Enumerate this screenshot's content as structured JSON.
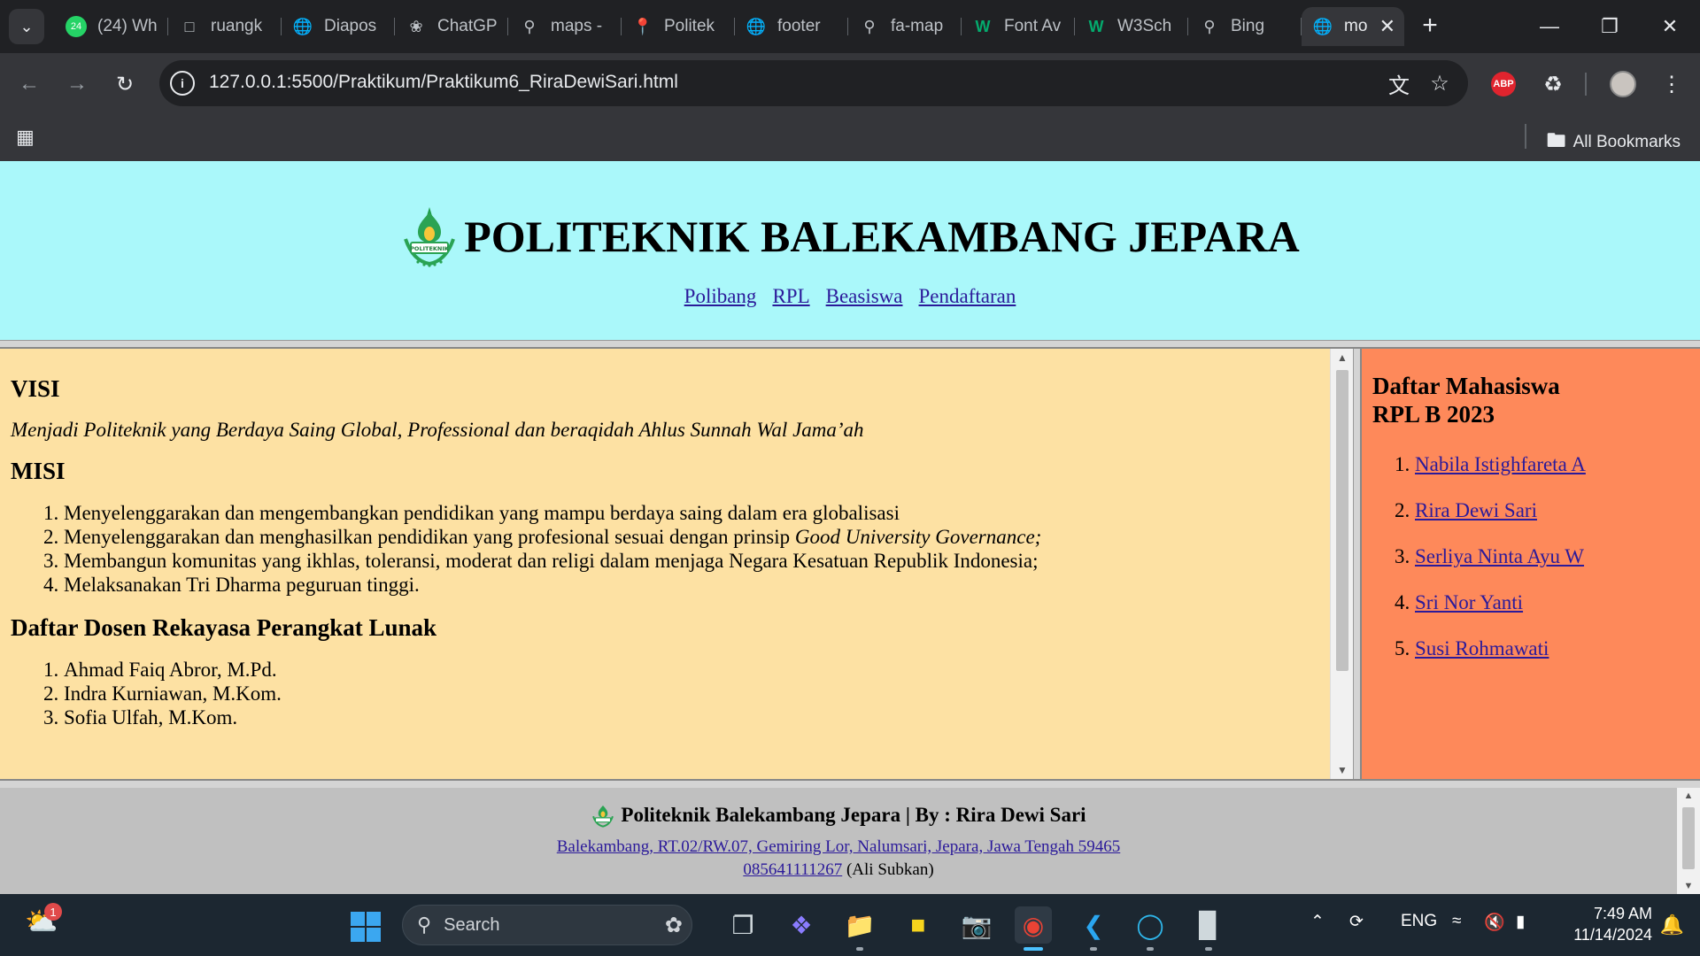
{
  "browser": {
    "tabs": [
      {
        "label": "(24) Wh",
        "icon": "whatsapp-icon",
        "badge": "24",
        "color": "#25d366"
      },
      {
        "label": "ruangk",
        "icon": "ruangkelas-icon"
      },
      {
        "label": "Diapos",
        "icon": "globe-icon"
      },
      {
        "label": "ChatGP",
        "icon": "chatgpt-icon"
      },
      {
        "label": "maps -",
        "icon": "search-icon"
      },
      {
        "label": "Politek",
        "icon": "maps-pin-icon"
      },
      {
        "label": "footer",
        "icon": "globe-icon"
      },
      {
        "label": "fa-map",
        "icon": "search-icon"
      },
      {
        "label": "Font Av",
        "icon": "w3schools-icon"
      },
      {
        "label": "W3Sch",
        "icon": "w3schools-icon"
      },
      {
        "label": "Bing",
        "icon": "search-icon"
      },
      {
        "label": "mo",
        "icon": "globe-icon",
        "active": true
      }
    ],
    "url": "127.0.0.1:5500/Praktikum/Praktikum6_RiraDewiSari.html",
    "bookmarks_label": "All Bookmarks"
  },
  "header": {
    "title": "POLITEKNIK BALEKAMBANG JEPARA",
    "nav": [
      "Polibang",
      "RPL",
      "Beasiswa",
      "Pendaftaran"
    ],
    "bg_color": "#aaf8fa"
  },
  "main": {
    "visi_heading": "VISI",
    "visi_text": "Menjadi Politeknik yang Berdaya Saing Global, Professional dan beraqidah Ahlus Sunnah Wal Jama’ah",
    "misi_heading": "MISI",
    "misi": [
      {
        "text": "Menyelenggarakan dan mengembangkan pendidikan yang mampu berdaya saing dalam era globalisasi",
        "em": ""
      },
      {
        "text": "Menyelenggarakan dan menghasilkan pendidikan yang profesional sesuai dengan prinsip ",
        "em": "Good University Governance;"
      },
      {
        "text": "Membangun komunitas yang ikhlas, toleransi, moderat dan religi dalam menjaga Negara Kesatuan Republik Indonesia;",
        "em": ""
      },
      {
        "text": "Melaksanakan Tri Dharma peguruan tinggi.",
        "em": ""
      }
    ],
    "dosen_heading": "Daftar Dosen Rekayasa Perangkat Lunak",
    "dosen": [
      "Ahmad Faiq Abror, M.Pd.",
      "Indra Kurniawan, M.Kom.",
      "Sofia Ulfah, M.Kom."
    ],
    "bg_color": "#fde1a3"
  },
  "aside": {
    "heading_line1": "Daftar Mahasiswa",
    "heading_line2": "RPL B 2023",
    "students": [
      "Nabila Istighfareta A",
      "Rira Dewi Sari",
      "Serliya Ninta Ayu W",
      "Sri Nor Yanti",
      "Susi Rohmawati"
    ],
    "bg_color": "#fe895a"
  },
  "footer": {
    "title": "Politeknik Balekambang Jepara | By : Rira Dewi Sari",
    "address": "Balekambang, RT.02/RW.07, Gemiring Lor, Nalumsari, Jepara, Jawa Tengah 59465",
    "phone": "085641111267",
    "phone_name": "(Ali Subkan)",
    "bg_color": "#c0c0c0"
  },
  "taskbar": {
    "weather_badge": "1",
    "search_placeholder": "Search",
    "language": "ENG",
    "time": "7:49 AM",
    "date": "11/14/2024",
    "apps": [
      "task-view-icon",
      "copilot-icon",
      "file-explorer-icon",
      "sticky-notes-icon",
      "camera-icon",
      "chrome-icon",
      "vscode-icon",
      "edge-icon",
      "terminal-icon"
    ]
  }
}
